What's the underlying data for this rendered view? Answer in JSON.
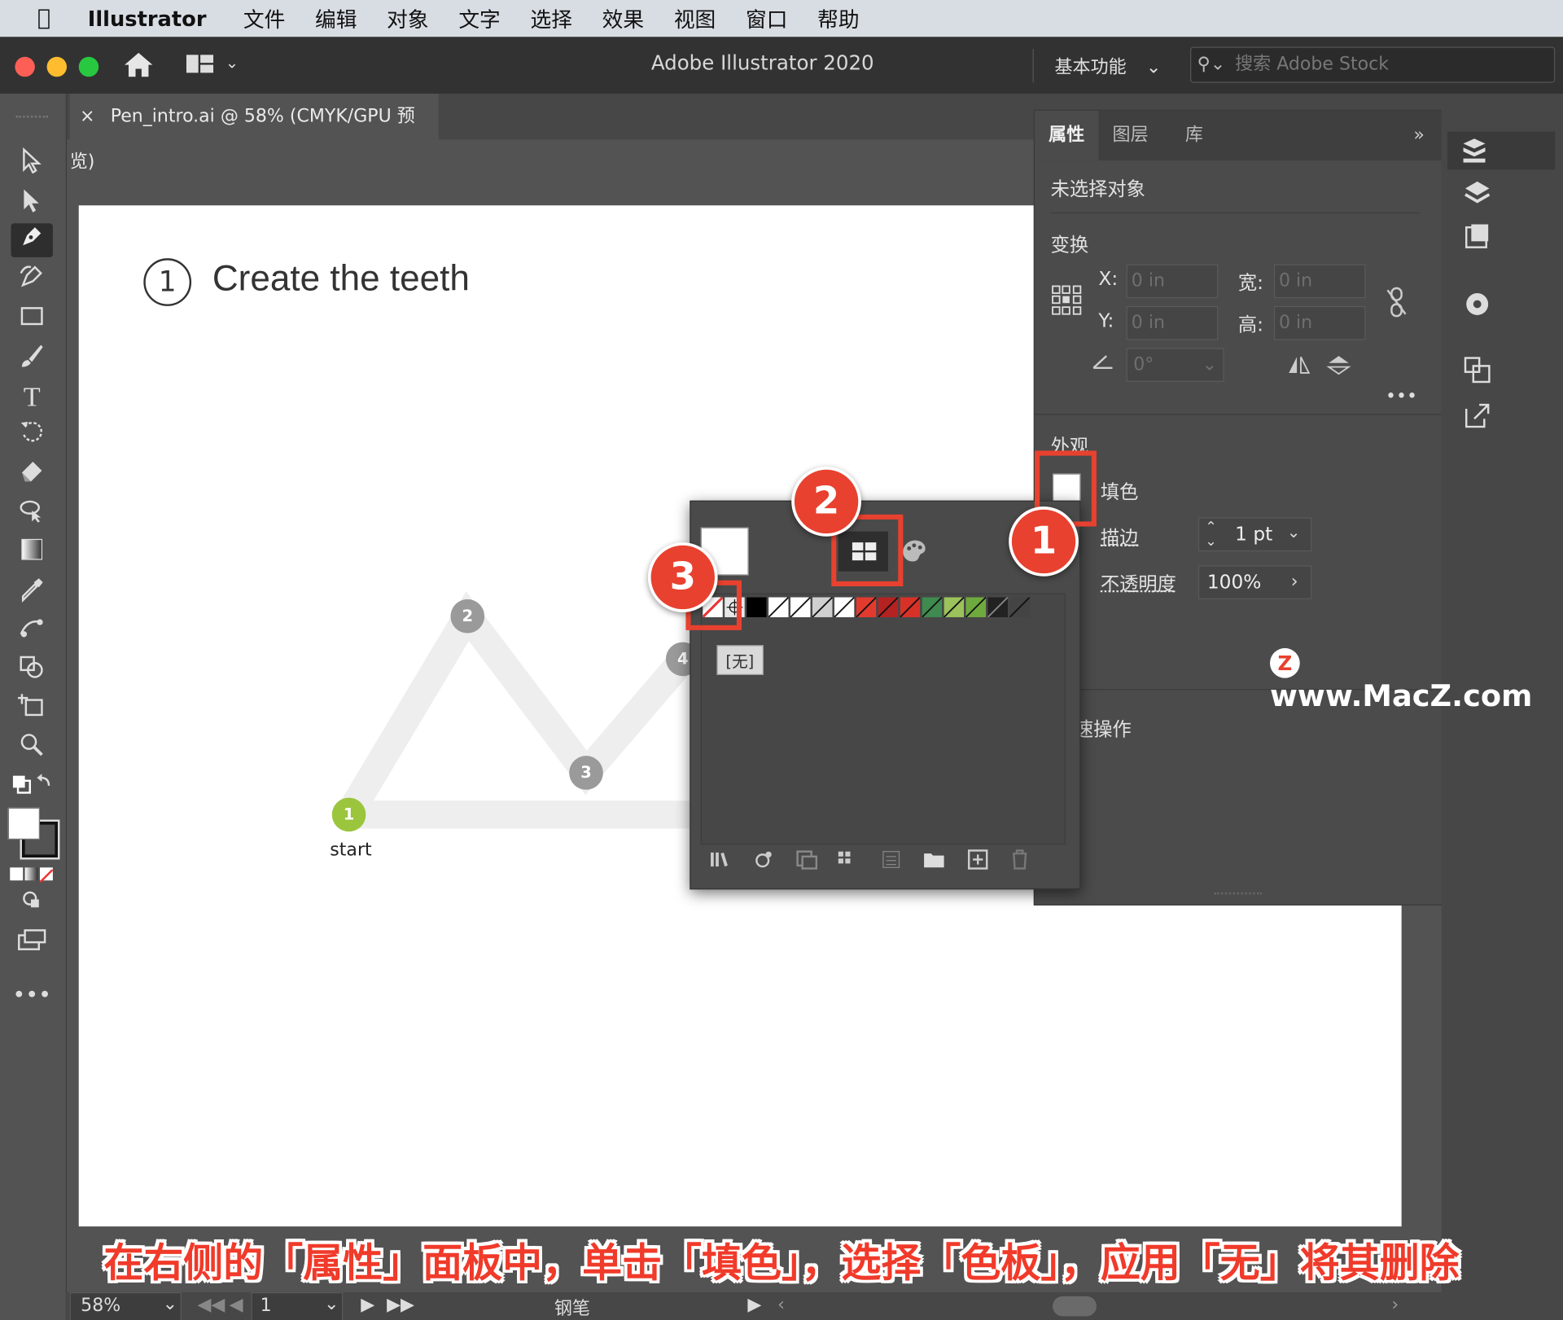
{
  "menubar": {
    "app_name": "Illustrator",
    "items": [
      "文件",
      "编辑",
      "对象",
      "文字",
      "选择",
      "效果",
      "视图",
      "窗口",
      "帮助"
    ]
  },
  "appbar": {
    "title": "Adobe Illustrator 2020",
    "workspace": "基本功能",
    "search_placeholder": "搜索 Adobe Stock"
  },
  "document": {
    "tab_title": "Pen_intro.ai @ 58% (CMYK/GPU 预览)",
    "close_glyph": "×"
  },
  "artboard": {
    "step_number": "1",
    "heading": "Create the teeth",
    "points": [
      "1",
      "2",
      "3",
      "4"
    ],
    "start_label": "start"
  },
  "panel": {
    "tabs": [
      "属性",
      "图层",
      "库"
    ],
    "no_selection": "未选择对象",
    "transform_title": "变换",
    "x_label": "X:",
    "y_label": "Y:",
    "x_value": "0 in",
    "y_value": "0 in",
    "w_label": "宽:",
    "h_label": "高:",
    "w_value": "0 in",
    "h_value": "0 in",
    "angle_value": "0°",
    "appearance_title": "外观",
    "fill_label": "填色",
    "stroke_label": "描边",
    "stroke_value": "1 pt",
    "opacity_label": "不透明度",
    "opacity_value": "100%",
    "quick_actions": "速操作"
  },
  "swatch_popup": {
    "tooltip": "[无]",
    "swatch_colors": [
      "#ffffff",
      "#000000",
      "#ffffff",
      "#ffffff",
      "#ffffff",
      "#d0d0d0",
      "#e33a2f",
      "#b52222",
      "#d83128",
      "#3f8a4f",
      "#9bc25b",
      "#6faa3e",
      "#222222",
      "#444444"
    ]
  },
  "callouts": [
    "1",
    "2",
    "3"
  ],
  "caption": "在右侧的「属性」面板中，单击「填色」，选择「色板」，应用「无」将其删除",
  "watermark": "www.MacZ.com",
  "statusbar": {
    "zoom": "58%",
    "page": "1",
    "tool_name": "钢笔"
  },
  "colors": {
    "accent_red": "#e8412f",
    "point_green": "#9bc53d",
    "point_gray": "#9a9a9a"
  }
}
